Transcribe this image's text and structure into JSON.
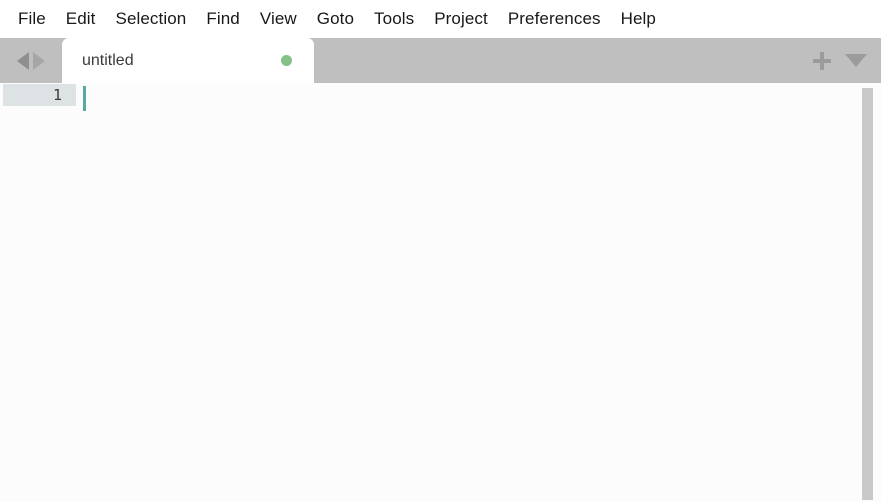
{
  "app": {
    "title": "untitled",
    "colors": {
      "menubar_bg": "#ffffff",
      "menu_text": "#181818",
      "tabstrip_bg": "#bfbfbf",
      "tab_active_bg": "#ffffff",
      "tab_label": "#3a3a3a",
      "dirty_dot": "#84c184",
      "editor_bg": "#fcfcfc",
      "gutter_active_line": "#dde2e4",
      "line_number": "#3c3c3c",
      "caret": "#57a8a0",
      "scrollbar_thumb": "#c9c9c9",
      "icon_gray": "#9b9b9b"
    }
  },
  "menubar": {
    "items": [
      {
        "label": "File"
      },
      {
        "label": "Edit"
      },
      {
        "label": "Selection"
      },
      {
        "label": "Find"
      },
      {
        "label": "View"
      },
      {
        "label": "Goto"
      },
      {
        "label": "Tools"
      },
      {
        "label": "Project"
      },
      {
        "label": "Preferences"
      },
      {
        "label": "Help"
      }
    ]
  },
  "tabstrip": {
    "nav": {
      "back_icon": "triangle-left-icon",
      "forward_icon": "triangle-right-icon"
    },
    "tabs": [
      {
        "label": "untitled",
        "active": true,
        "modified": true,
        "modified_indicator": "green-dot"
      }
    ],
    "actions": [
      {
        "icon": "plus-icon",
        "name": "new-tab-button"
      },
      {
        "icon": "caret-down-icon",
        "name": "tab-list-dropdown-button"
      }
    ]
  },
  "editor": {
    "lines": [
      {
        "number": "1",
        "text": "",
        "active": true
      }
    ],
    "caret": {
      "line": 1,
      "column": 1
    },
    "scrollbar": {
      "orientation": "vertical",
      "visible": true
    }
  }
}
